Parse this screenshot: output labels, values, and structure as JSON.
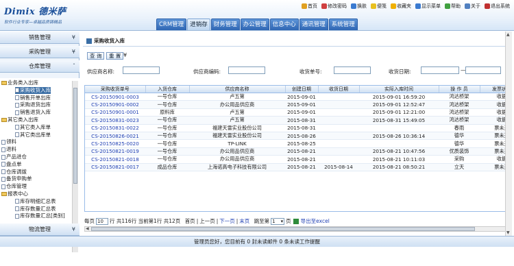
{
  "logo": {
    "brand": "Dimix 德米萨",
    "slogan": "软件行业专家—卓越品质铸精品"
  },
  "toplinks": [
    {
      "label": "首页",
      "icon": "home-icon",
      "color": "#e0a020"
    },
    {
      "label": "修改密码",
      "icon": "key-icon",
      "color": "#d04040"
    },
    {
      "label": "换肤",
      "icon": "skin-icon",
      "color": "#3a7ad0"
    },
    {
      "label": "便笺",
      "icon": "note-icon",
      "color": "#e8c020"
    },
    {
      "label": "收藏夹",
      "icon": "star-icon",
      "color": "#f0b000"
    },
    {
      "label": "显示菜单",
      "icon": "menu-icon",
      "color": "#3a7ad0"
    },
    {
      "label": "帮助",
      "icon": "help-icon",
      "color": "#40a040"
    },
    {
      "label": "关于",
      "icon": "about-icon",
      "color": "#5080c0"
    },
    {
      "label": "退出系统",
      "icon": "exit-icon",
      "color": "#c03030"
    }
  ],
  "navtabs": [
    "CRM管理",
    "进销存",
    "财务管理",
    "办公管理",
    "信息中心",
    "通讯管理",
    "系统管理"
  ],
  "active_tab": 1,
  "sidebar": {
    "headers": [
      "销售管理",
      "采购管理",
      "仓库管理"
    ],
    "footer": "物流管理",
    "tree": [
      {
        "label": "业务类入出库",
        "type": "folder",
        "level": 0
      },
      {
        "label": "采购收货入库",
        "type": "doc",
        "level": 1
      },
      {
        "label": "销售开单出库",
        "type": "doc",
        "level": 1
      },
      {
        "label": "采购退货出库",
        "type": "doc",
        "level": 1
      },
      {
        "label": "销售退货入库",
        "type": "doc",
        "level": 1
      },
      {
        "label": "其它类入出库",
        "type": "folder",
        "level": 0
      },
      {
        "label": "其它类入库单",
        "type": "doc",
        "level": 1
      },
      {
        "label": "其它类出库单",
        "type": "doc",
        "level": 1
      },
      {
        "label": "领料",
        "type": "doc",
        "level": 0
      },
      {
        "label": "退料",
        "type": "doc",
        "level": 0
      },
      {
        "label": "产品进仓",
        "type": "doc",
        "level": 0
      },
      {
        "label": "盘点单",
        "type": "doc",
        "level": 0
      },
      {
        "label": "仓库调拨",
        "type": "doc",
        "level": 0
      },
      {
        "label": "备货申购单",
        "type": "doc",
        "level": 0
      },
      {
        "label": "仓库管理",
        "type": "doc",
        "level": 0
      },
      {
        "label": "报表中心",
        "type": "folder",
        "level": 0
      },
      {
        "label": "库存明细汇总表",
        "type": "doc",
        "level": 1
      },
      {
        "label": "库存数量汇总表",
        "type": "doc",
        "level": 1
      },
      {
        "label": "库存数量汇总[类别]",
        "type": "doc",
        "level": 1
      }
    ],
    "selected": 1
  },
  "page": {
    "title": "采购收货入库"
  },
  "toolbar": {
    "query": "查 询",
    "reset": "重 置"
  },
  "filters": {
    "supplier_name": "供应商名称:",
    "supplier_code": "供应商编码:",
    "receipt_no": "收货单号:",
    "receipt_date": "收货日期:"
  },
  "table": {
    "headers": [
      "采购收货单号",
      "入货仓库",
      "供应商名称",
      "创建日期",
      "收货日期",
      "实际入库时间",
      "操 作 员",
      "发票状态"
    ],
    "rows": [
      [
        "CS-20150901-0003",
        "一号仓库",
        "卢五第",
        "2015-09-01",
        "",
        "2015-09-01 16:59:20",
        "鸿达桥架",
        "收据"
      ],
      [
        "CS-20150901-0002",
        "一号仓库",
        "办公用品供应商",
        "2015-09-01",
        "",
        "2015-09-01 12:52:47",
        "鸿达桥架",
        "收据"
      ],
      [
        "CS-20150901-0001",
        "原料库",
        "卢五第",
        "2015-09-01",
        "",
        "2015-09-01 12:21:00",
        "鸿达桥架",
        "收据"
      ],
      [
        "CS-20150831-0023",
        "一号仓库",
        "卢五第",
        "2015-08-31",
        "",
        "2015-08-31 15:49:05",
        "鸿达桥架",
        "收据"
      ],
      [
        "CS-20150831-0022",
        "一号仓库",
        "福建天雷实业股份公司",
        "2015-08-31",
        "",
        "",
        "春雨",
        "票未开"
      ],
      [
        "CS-20150826-0021",
        "一号仓库",
        "福建天雷实业股份公司",
        "2015-08-26",
        "",
        "2015-08-26 10:36:14",
        "德华",
        "票未开"
      ],
      [
        "CS-20150825-0020",
        "一号仓库",
        "TP-LINK",
        "2015-08-25",
        "",
        "",
        "德华",
        "票未开"
      ],
      [
        "CS-20150821-0019",
        "一号仓库",
        "办公用品供应商",
        "2015-08-21",
        "",
        "2015-08-21 10:47:56",
        "优质装饰",
        "票未开"
      ],
      [
        "CS-20150821-0018",
        "一号仓库",
        "办公用品供应商",
        "2015-08-21",
        "",
        "2015-08-21 10:11:03",
        "采购",
        "收据"
      ],
      [
        "CS-20150821-0017",
        "成品仓库",
        "上海诺高电子科技有限公司",
        "2015-08-21",
        "2015-08-14",
        "2015-08-21 08:50:21",
        "立天",
        "票未开"
      ]
    ]
  },
  "pager": {
    "per_page_label": "每页",
    "per_page_value": "10",
    "per_page_suffix": "行 共116行 当前第1行 共12页",
    "first": "首页",
    "prev": "上一页",
    "next": "下一页",
    "last": "末页",
    "jump_label": "跳至第",
    "jump_value": "1",
    "page_suffix": "页",
    "export": "导出至excel"
  },
  "statusbar": "管理员您好，您目前有 0 封未读邮件 0 条未读工作提醒"
}
